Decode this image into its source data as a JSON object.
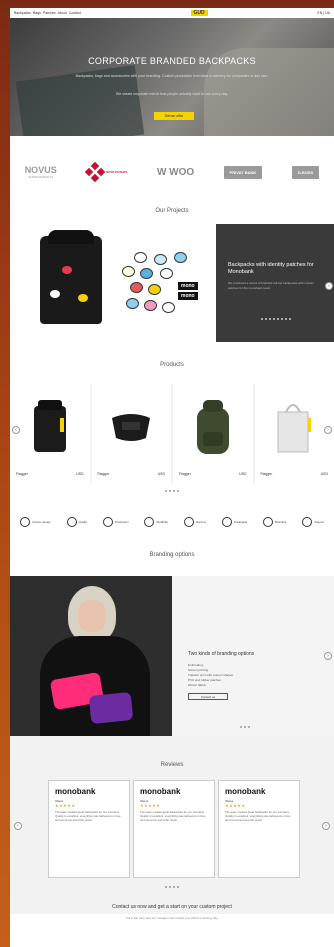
{
  "topbar": {
    "left_links": [
      "Backpacks",
      "Bags",
      "Patches",
      "About",
      "Contact"
    ],
    "logo": "GUD",
    "right": "EN | UA"
  },
  "hero": {
    "title": "CORPORATE BRANDED BACKPACKS",
    "sub1": "Backpacks, bags and accessories with your branding. Custom production from idea to delivery for companies of any size.",
    "sub2": "We create corporate merch that people actually want to use every day.",
    "button": "Get an offer"
  },
  "partners": [
    {
      "name": "NOVUS",
      "sub": "SUPERMARKETS",
      "style": "novus"
    },
    {
      "name": "NOVA POSHTA",
      "style": "nova"
    },
    {
      "name": "W WOO",
      "style": "woo"
    },
    {
      "name": "PRIVAT BANK",
      "style": "box"
    },
    {
      "name": "D-BOSS",
      "style": "box"
    }
  ],
  "projects": {
    "title": "Our Projects",
    "card_title": "Backpacks with identity patches for Monobank",
    "card_desc": "We produced a series of branded roll-top backpacks with custom patches for the monobank team."
  },
  "products": {
    "title": "Products",
    "items": [
      {
        "name": "Flagger",
        "price": "USD"
      },
      {
        "name": "Flagger",
        "price": "USD"
      },
      {
        "name": "Flagger",
        "price": "USD"
      },
      {
        "name": "Flagger",
        "price": "USD"
      }
    ]
  },
  "features": [
    "Custom design",
    "Quality",
    "Production",
    "Durability",
    "Delivery",
    "Packaging",
    "Branding",
    "Support"
  ],
  "branding": {
    "title": "Branding options",
    "heading": "Two kinds of branding options",
    "list": [
      "Embroidery",
      "Screen printing",
      "Transfer print with custom shapes",
      "PVC and rubber patches",
      "Woven labels"
    ],
    "button": "Contact us"
  },
  "reviews": {
    "title": "Reviews",
    "items": [
      {
        "brand": "monobank",
        "name": "Olena",
        "stars": "★★★★★",
        "text": "The team created great backpacks for our company. Quality is excellent, everything was delivered on time and everyone loved the result."
      },
      {
        "brand": "monobank",
        "name": "Olena",
        "stars": "★★★★★",
        "text": "The team created great backpacks for our company. Quality is excellent, everything was delivered on time and everyone loved the result."
      },
      {
        "brand": "monobank",
        "name": "Olena",
        "stars": "★★★★★",
        "text": "The team created great backpacks for our company. Quality is excellent, everything was delivered on time and everyone loved the result."
      }
    ]
  },
  "contact": {
    "title": "Contact us now and get a start on your custom project",
    "sub": "Fill in the form and our manager will contact you within a working day"
  }
}
